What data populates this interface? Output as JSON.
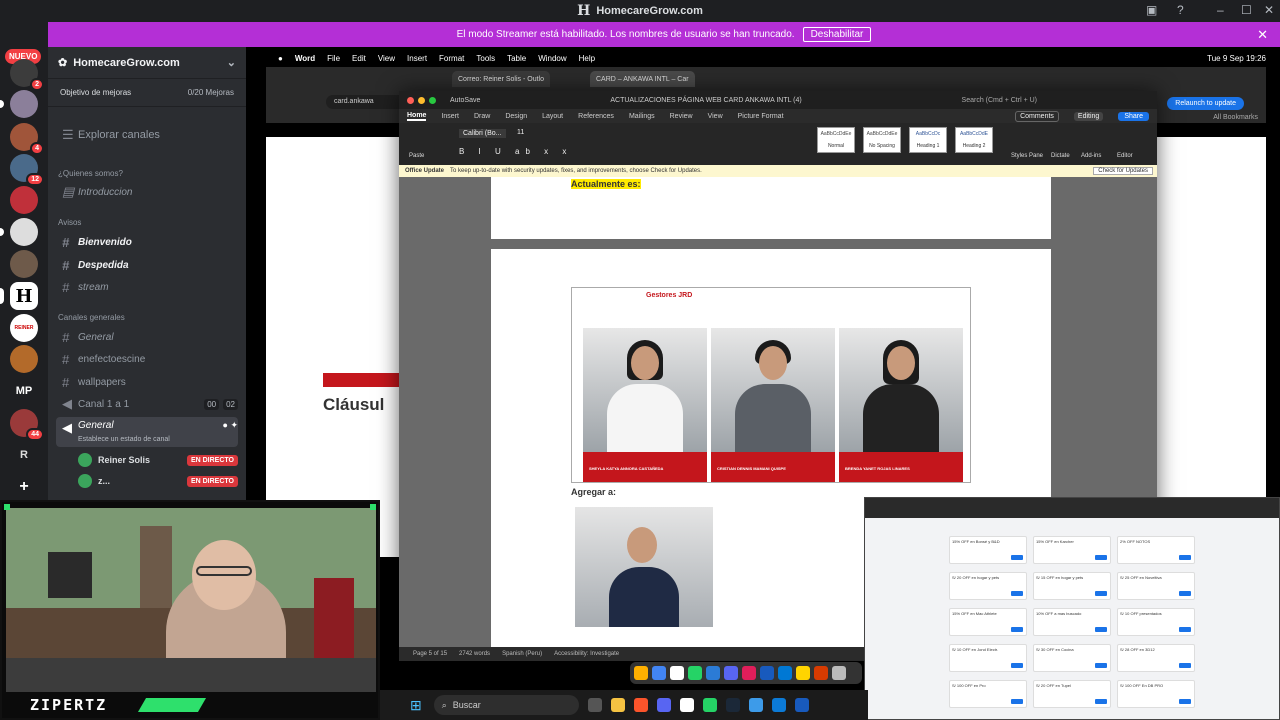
{
  "window": {
    "title": "HomecareGrow.com",
    "logo_letter": "H"
  },
  "banner": {
    "text": "El modo Streamer está habilitado. Los nombres de usuario se han truncado.",
    "button": "Deshabilitar"
  },
  "rail": {
    "nuevo": "NUEVO",
    "nuevo_badge": "2",
    "badges": [
      "4",
      "12",
      "44"
    ],
    "server_labels": [
      "REINER",
      "MP",
      "R"
    ],
    "add": "+"
  },
  "server": {
    "name": "HomecareGrow.com",
    "goal_label": "Objetivo de mejoras",
    "goal_count": "0/20 Mejoras",
    "explore": "Explorar canales",
    "categories": {
      "quienes": "¿Quienes somos?",
      "avisos": "Avisos",
      "generales": "Canales generales"
    },
    "channels": {
      "introduccion": "Introduccion",
      "bienvenido": "Bienvenido",
      "despedida": "Despedida",
      "stream": "stream",
      "general": "General",
      "enefecto": "enefectoescine",
      "wallpapers": "wallpapers",
      "canal1": "Canal 1 a 1",
      "canal1_left": "00",
      "canal1_right": "02",
      "voice_general": "General",
      "voice_status": "Establece un estado de canal"
    },
    "voice_users": [
      {
        "name": "Reiner Solis",
        "badge": "EN DIRECTO"
      },
      {
        "name": "z...",
        "badge": "EN DIRECTO"
      }
    ]
  },
  "mac": {
    "menu": [
      "Word",
      "File",
      "Edit",
      "View",
      "Insert",
      "Format",
      "Tools",
      "Table",
      "Window",
      "Help"
    ],
    "clock": "Tue 9 Sep 19:26"
  },
  "browser": {
    "tabs": [
      "Correo: Reiner Solis - Outlo",
      "CARD – ANKAWA INTL – Car"
    ],
    "address": "card.ankawa",
    "relaunch": "Relaunch to update",
    "bookmarks": "All Bookmarks",
    "page_heading": "Cláusul"
  },
  "word": {
    "autosave": "AutoSave",
    "doc_title": "ACTUALIZACIONES PÁGINA WEB CARD ANKAWA INTL (4)",
    "search": "Search (Cmd + Ctrl + U)",
    "tabs": [
      "Home",
      "Insert",
      "Draw",
      "Design",
      "Layout",
      "References",
      "Mailings",
      "Review",
      "View",
      "Picture Format"
    ],
    "comments": "Comments",
    "editing": "Editing",
    "share": "Share",
    "font": "Calibri (Bo...",
    "size": "11",
    "styles": [
      {
        "sample": "AaBbCcDdEe",
        "name": "Normal"
      },
      {
        "sample": "AaBbCcDdEe",
        "name": "No Spacing"
      },
      {
        "sample": "AaBbCcDc",
        "name": "Heading 1"
      },
      {
        "sample": "AaBbCcDdE",
        "name": "Heading 2"
      }
    ],
    "ribbon_buttons": [
      "Paste",
      "Styles Pane",
      "Dictate",
      "Add-ins",
      "Editor"
    ],
    "notice_title": "Office Update",
    "notice": "To keep up-to-date with security updates, fixes, and improvements, choose Check for Updates.",
    "notice_button": "Check for Updates",
    "doc": {
      "highlight": "Actualmente es:",
      "photo_heading": "Gestores JRD",
      "people": [
        "SHEYLA KATYA ANNORA CASTAÑEDA",
        "CRISTIAN DENNIS MAMANI QUISPE",
        "BRENDA YANET ROJAS LINARES"
      ],
      "agregar": "Agregar a:"
    },
    "status": {
      "page": "Page 5 of 15",
      "words": "2742 words",
      "lang": "Spanish (Peru)",
      "access": "Accessibility: Investigate"
    }
  },
  "coupons": [
    "15% OFF en Bonsé y B&D",
    "15% OFF en Karcher",
    "2% OFF NOTOS",
    "S/ 20 OFF en hogar y pets",
    "S/ 15 OFF en hogar y pets",
    "S/ 25 OFF en Noveltiva",
    "15% OFF en Mac Athlete",
    "10% OFF a mas buscado",
    "S/ 10 OFF presentados",
    "S/ 10 OFF en Jond Electr.",
    "S/ 30 OFF en Cocina",
    "S/ 28 OFF en 3D12",
    "S/ 100 OFF en Pro",
    "S/ 20 OFF en Tupel",
    "S/ 100 OFF En DB PRO"
  ],
  "taskbar": {
    "search": "Buscar"
  },
  "webcam": {
    "name": "ZIPERTZ"
  },
  "colors": {
    "banner": "#b42fd6",
    "live": "#da373c",
    "accent_red": "#c4161c",
    "discord_bg": "#2b2d31"
  }
}
